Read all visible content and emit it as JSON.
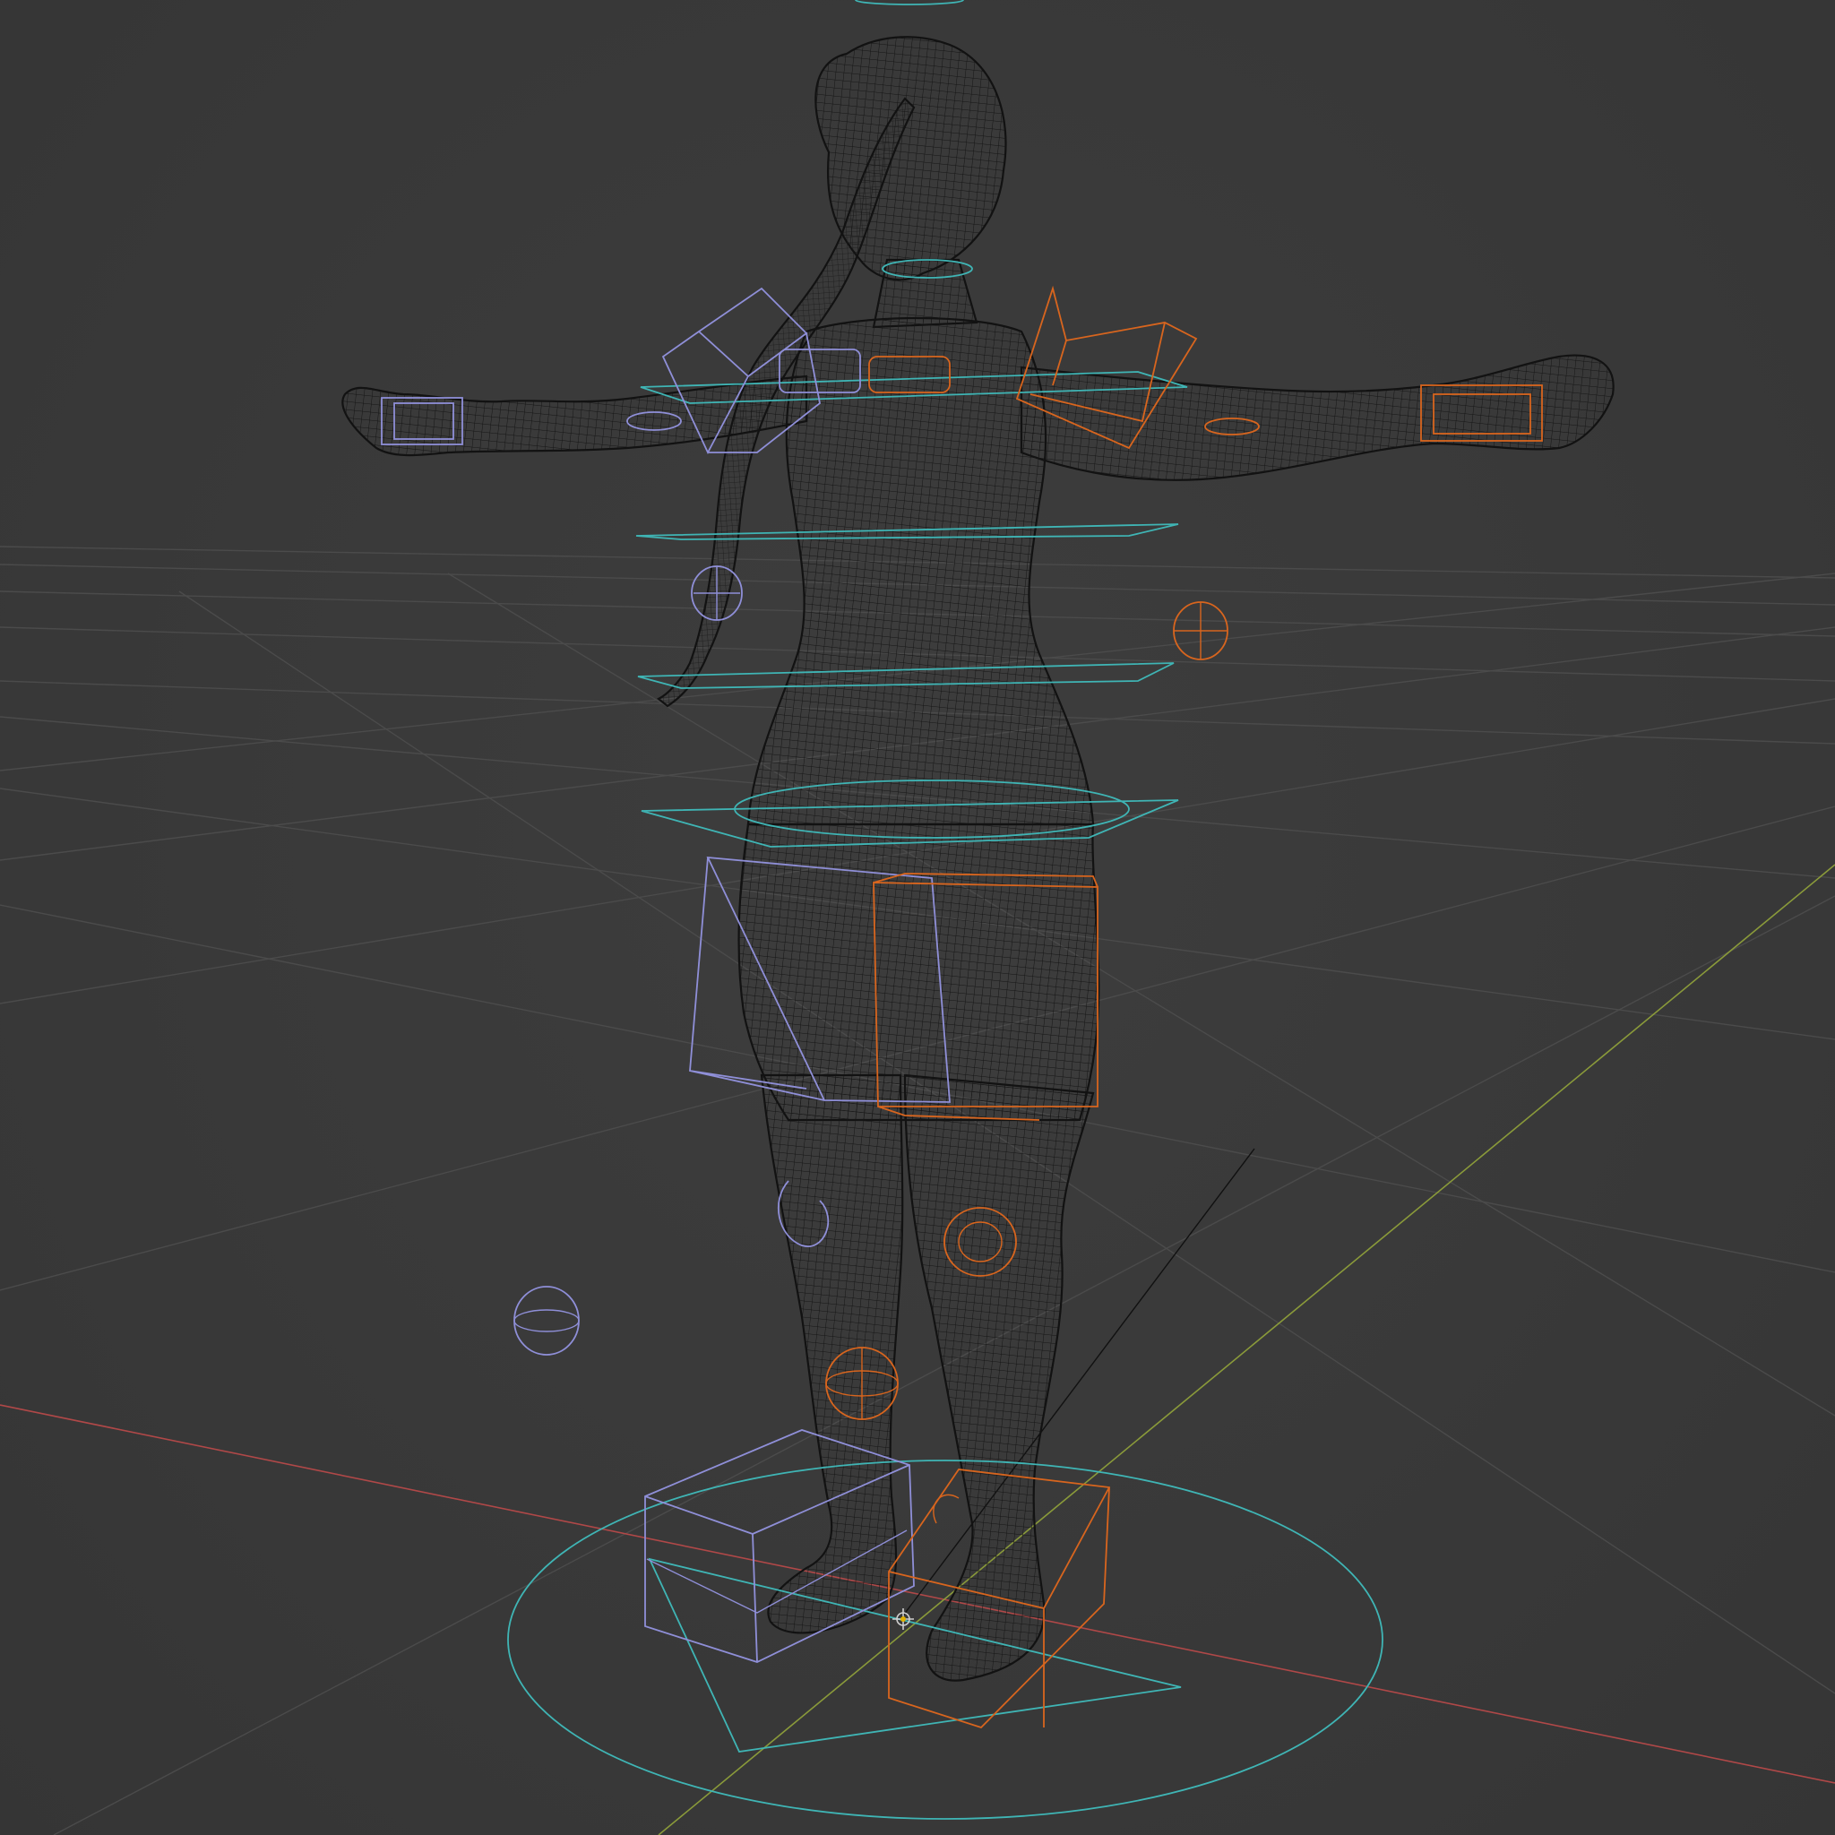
{
  "viewport": {
    "mode": "wireframe",
    "background_color": "#393939",
    "grid_color": "#4a4a4a",
    "axis_x_color": "#b04848",
    "axis_y_color": "#8a9a3a",
    "mesh_color": "#141414",
    "control_colors": {
      "center": "#3fb5b5",
      "left": "#8f8fd8",
      "right": "#d8651e"
    }
  },
  "scene": {
    "object": "character-mesh-t-pose",
    "rig": "armature-control-widgets"
  }
}
